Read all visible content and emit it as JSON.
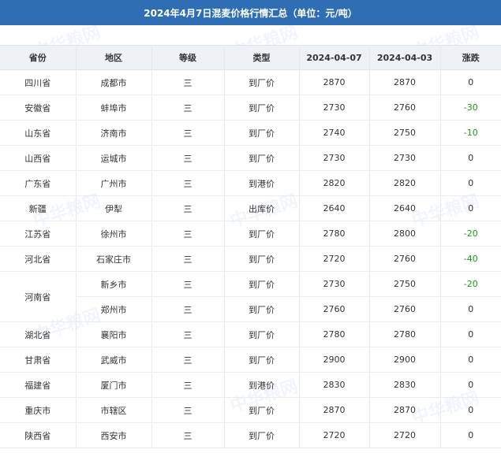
{
  "title": "2024年4月7日混麦价格行情汇总（单位：元/吨）",
  "headers": [
    "省份",
    "地区",
    "等级",
    "类型",
    "2024-04-07",
    "2024-04-03",
    "涨跌"
  ],
  "rows": [
    {
      "province": "四川省",
      "city": "成都市",
      "grade": "三",
      "type": "到厂价",
      "p1": "2870",
      "p2": "2870",
      "change": "0"
    },
    {
      "province": "安徽省",
      "city": "蚌埠市",
      "grade": "三",
      "type": "到厂价",
      "p1": "2730",
      "p2": "2760",
      "change": "-30"
    },
    {
      "province": "山东省",
      "city": "济南市",
      "grade": "三",
      "type": "到厂价",
      "p1": "2740",
      "p2": "2750",
      "change": "-10"
    },
    {
      "province": "山西省",
      "city": "运城市",
      "grade": "三",
      "type": "到厂价",
      "p1": "2730",
      "p2": "2730",
      "change": "0"
    },
    {
      "province": "广东省",
      "city": "广州市",
      "grade": "三",
      "type": "到港价",
      "p1": "2820",
      "p2": "2820",
      "change": "0"
    },
    {
      "province": "新疆",
      "city": "伊犁",
      "grade": "三",
      "type": "出库价",
      "p1": "2640",
      "p2": "2640",
      "change": "0"
    },
    {
      "province": "江苏省",
      "city": "徐州市",
      "grade": "三",
      "type": "到厂价",
      "p1": "2780",
      "p2": "2800",
      "change": "-20"
    },
    {
      "province": "河北省",
      "city": "石家庄市",
      "grade": "三",
      "type": "到厂价",
      "p1": "2720",
      "p2": "2760",
      "change": "-40"
    },
    {
      "province": "河南省",
      "city": "新乡市",
      "grade": "三",
      "type": "到厂价",
      "p1": "2730",
      "p2": "2750",
      "change": "-20"
    },
    {
      "province": "",
      "city": "郑州市",
      "grade": "三",
      "type": "到厂价",
      "p1": "2760",
      "p2": "2760",
      "change": "0"
    },
    {
      "province": "湖北省",
      "city": "襄阳市",
      "grade": "三",
      "type": "到厂价",
      "p1": "2780",
      "p2": "2780",
      "change": "0"
    },
    {
      "province": "甘肃省",
      "city": "武威市",
      "grade": "三",
      "type": "到厂价",
      "p1": "2900",
      "p2": "2900",
      "change": "0"
    },
    {
      "province": "福建省",
      "city": "厦门市",
      "grade": "三",
      "type": "到港价",
      "p1": "2830",
      "p2": "2830",
      "change": "0"
    },
    {
      "province": "重庆市",
      "city": "市辖区",
      "grade": "三",
      "type": "到厂价",
      "p1": "2870",
      "p2": "2870",
      "change": "0"
    },
    {
      "province": "陕西省",
      "city": "西安市",
      "grade": "三",
      "type": "到厂价",
      "p1": "2720",
      "p2": "2720",
      "change": "0"
    }
  ],
  "watermark": "中华粮网",
  "colors": {
    "header_bar": "#2f6db5",
    "negative": "#1a9a1a"
  }
}
